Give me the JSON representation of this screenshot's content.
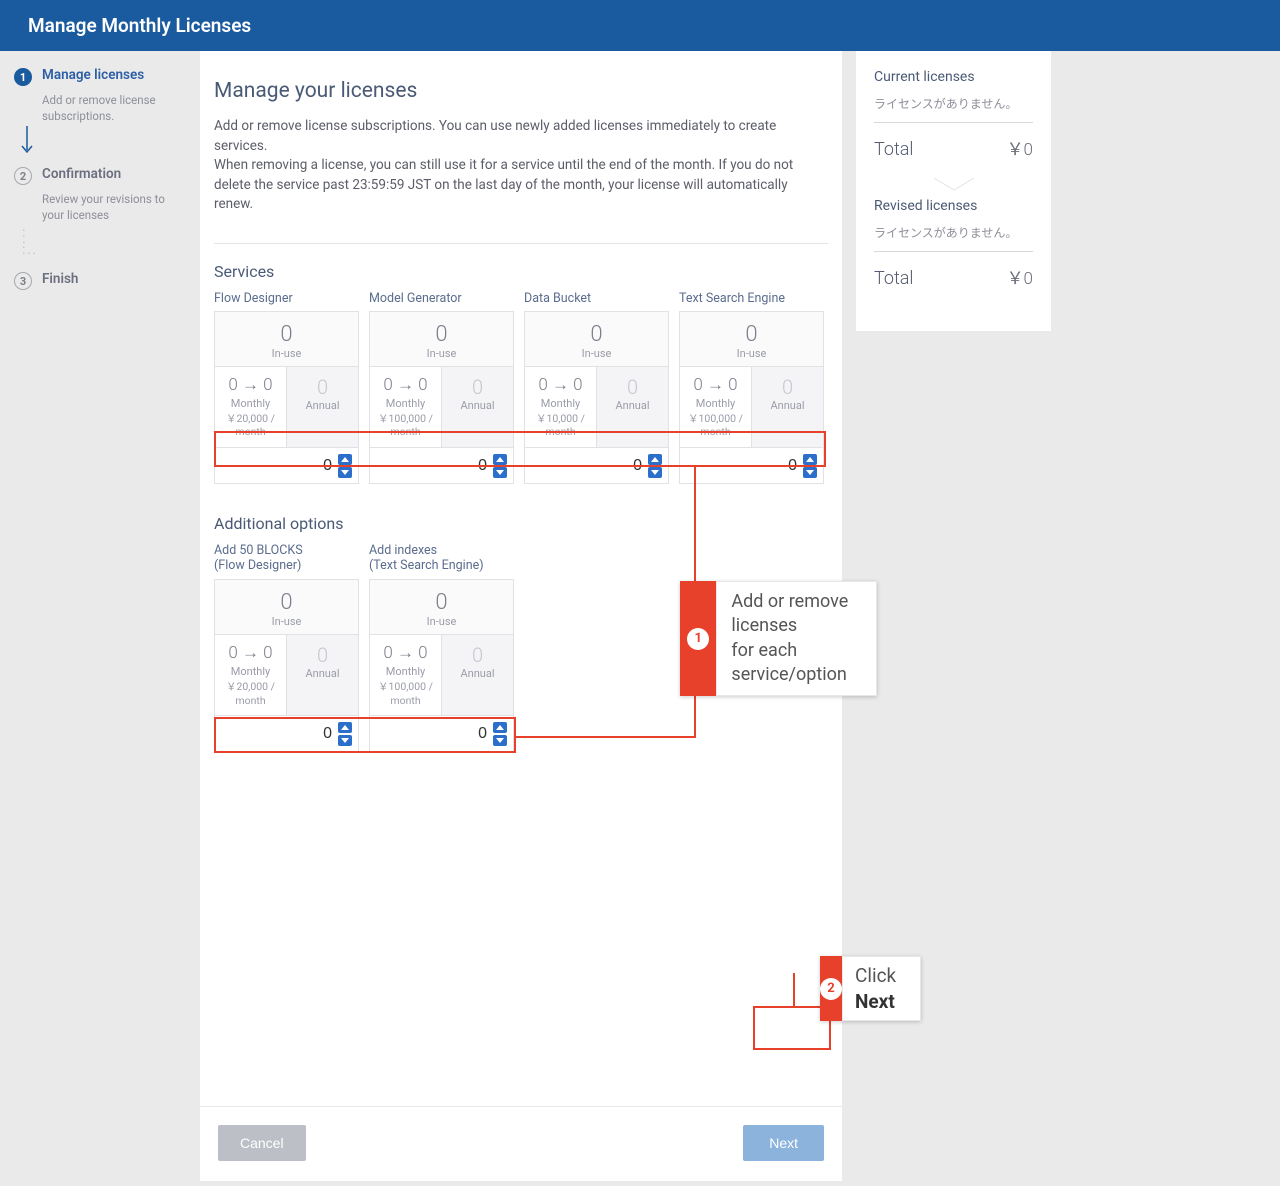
{
  "header": {
    "title": "Manage Monthly Licenses"
  },
  "sidebar": {
    "steps": [
      {
        "num": "1",
        "title": "Manage licenses",
        "desc": "Add or remove license subscriptions."
      },
      {
        "num": "2",
        "title": "Confirmation",
        "desc": "Review your revisions to your licenses"
      },
      {
        "num": "3",
        "title": "Finish",
        "desc": ""
      }
    ]
  },
  "main": {
    "heading": "Manage your licenses",
    "intro_l1": "Add or remove license subscriptions. You can use newly added licenses immediately to create services.",
    "intro_l2": "When removing a license, you can still use it for a service until the end of the month. If you do not delete the service past 23:59:59 JST on the last day of the month, your license will automatically renew.",
    "services_heading": "Services",
    "options_heading": "Additional options",
    "labels": {
      "inuse": "In-use",
      "monthly": "Monthly",
      "annual": "Annual",
      "zero_arrow": "0 → 0"
    },
    "services": [
      {
        "name": "Flow Designer",
        "inuse": "0",
        "annual": "0",
        "price": "￥20,000 / month",
        "value": "0"
      },
      {
        "name": "Model Generator",
        "inuse": "0",
        "annual": "0",
        "price": "￥100,000 / month",
        "value": "0"
      },
      {
        "name": "Data Bucket",
        "inuse": "0",
        "annual": "0",
        "price": "￥10,000 / month",
        "value": "0"
      },
      {
        "name": "Text Search Engine",
        "inuse": "0",
        "annual": "0",
        "price": "￥100,000 / month",
        "value": "0"
      }
    ],
    "options": [
      {
        "name_l1": "Add 50 BLOCKS",
        "name_l2": "(Flow Designer)",
        "inuse": "0",
        "annual": "0",
        "price": "￥20,000 / month",
        "value": "0"
      },
      {
        "name_l1": "Add indexes",
        "name_l2": "(Text Search Engine)",
        "inuse": "0",
        "annual": "0",
        "price": "￥100,000 / month",
        "value": "0"
      }
    ],
    "buttons": {
      "cancel": "Cancel",
      "next": "Next"
    }
  },
  "right": {
    "current_heading": "Current licenses",
    "current_empty": "ライセンスがありません。",
    "total_label": "Total",
    "current_total": "￥0",
    "revised_heading": "Revised licenses",
    "revised_empty": "ライセンスがありません。",
    "revised_total": "￥0"
  },
  "annotations": {
    "a1_num": "1",
    "a1_text_l1": "Add or remove licenses",
    "a1_text_l2": "for each service/option",
    "a2_num": "2",
    "a2_prefix": "Click ",
    "a2_bold": "Next"
  }
}
